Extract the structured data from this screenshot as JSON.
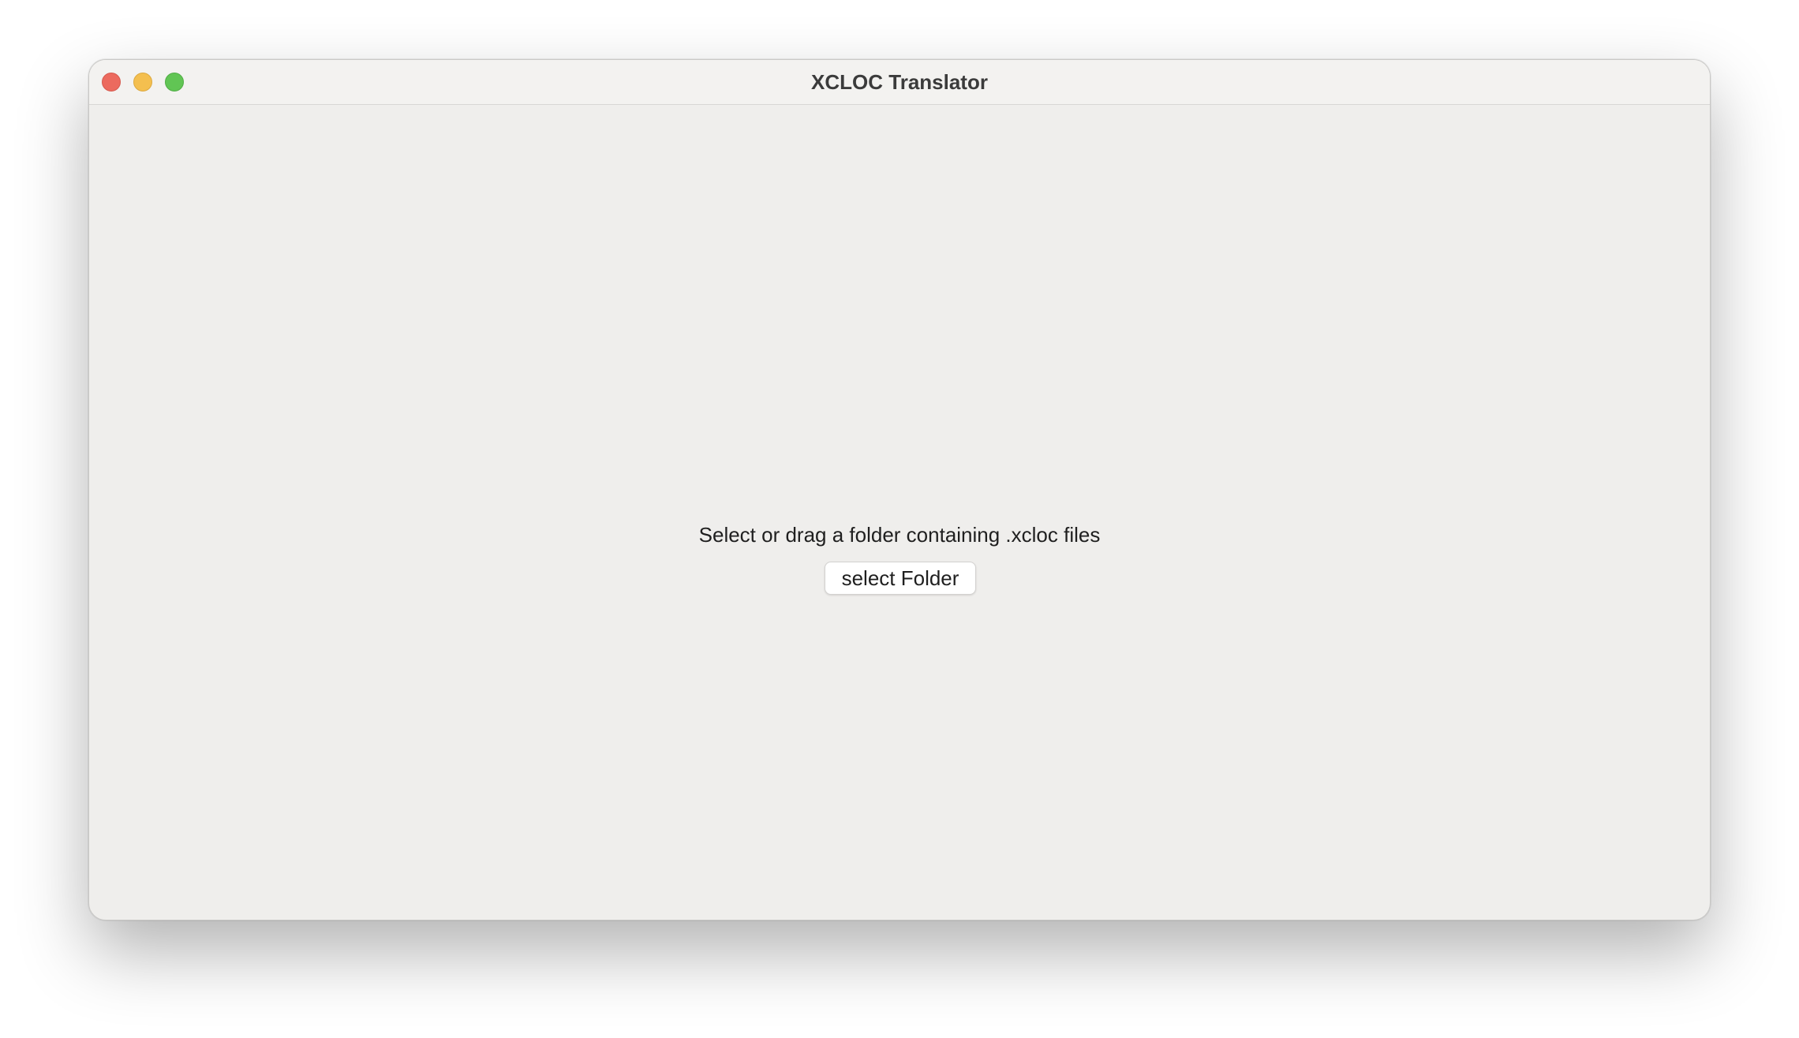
{
  "window": {
    "title": "XCLOC Translator",
    "controls": {
      "close_color": "#ec6a5e",
      "minimize_color": "#f4bf4f",
      "zoom_color": "#61c554"
    }
  },
  "main": {
    "prompt": "Select or drag a folder containing .xcloc files",
    "select_button_label": "select Folder"
  }
}
